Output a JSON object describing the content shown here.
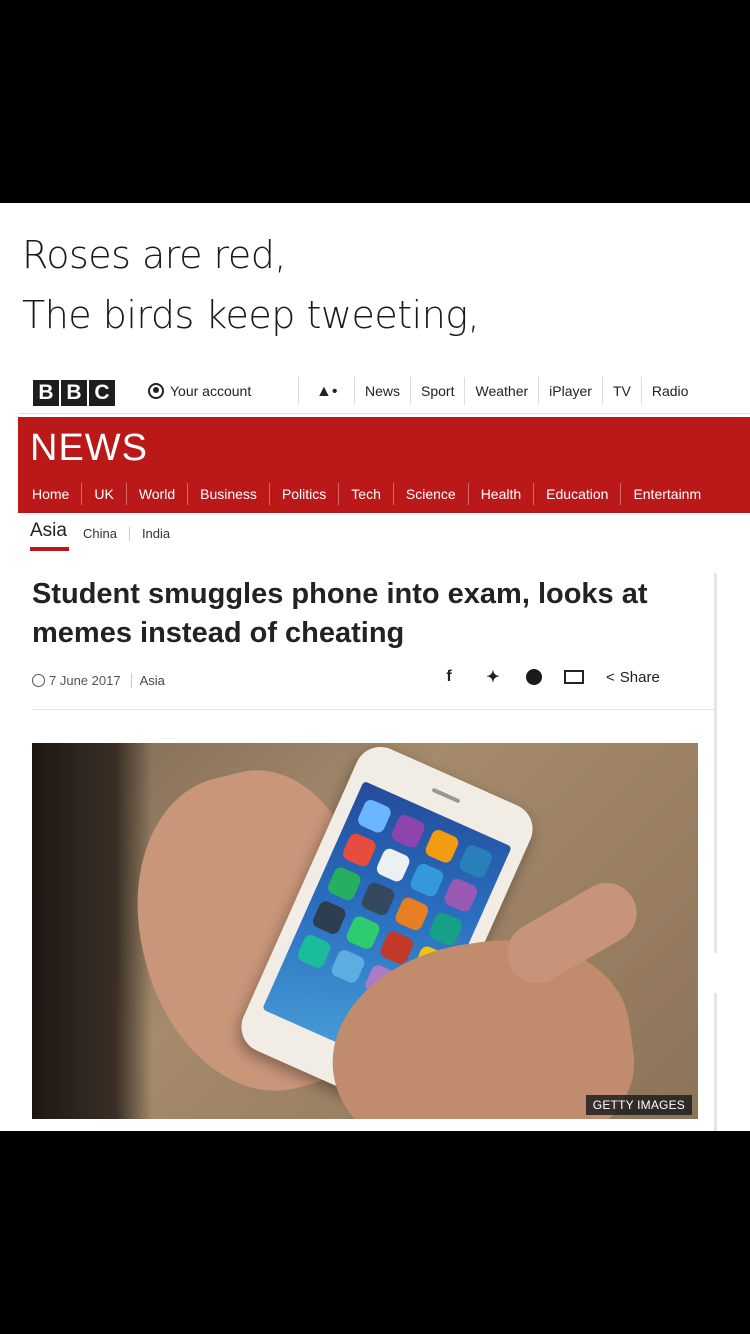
{
  "meme": {
    "line1": "Roses are red,",
    "line2": "The birds keep tweeting,"
  },
  "bbc": {
    "logo": [
      "B",
      "B",
      "C"
    ],
    "account": "Your account",
    "top_nav": [
      "News",
      "Sport",
      "Weather",
      "iPlayer",
      "TV",
      "Radio"
    ],
    "news_title": "NEWS",
    "section_nav": [
      "Home",
      "UK",
      "World",
      "Business",
      "Politics",
      "Tech",
      "Science",
      "Health",
      "Education",
      "Entertainm"
    ],
    "sub_nav": {
      "active": "Asia",
      "items": [
        "China",
        "India"
      ]
    }
  },
  "article": {
    "headline": "Student smuggles phone into exam, looks at memes instead of cheating",
    "date": "7 June 2017",
    "tag": "Asia",
    "share_label": "Share",
    "image_credit": "GETTY IMAGES"
  },
  "colors": {
    "bbc_red": "#bb1919",
    "background": "#000000"
  },
  "icons": [
    "account-icon",
    "bell-icon",
    "clock-icon",
    "facebook-icon",
    "twitter-icon",
    "messenger-icon",
    "email-icon",
    "share-icon"
  ]
}
